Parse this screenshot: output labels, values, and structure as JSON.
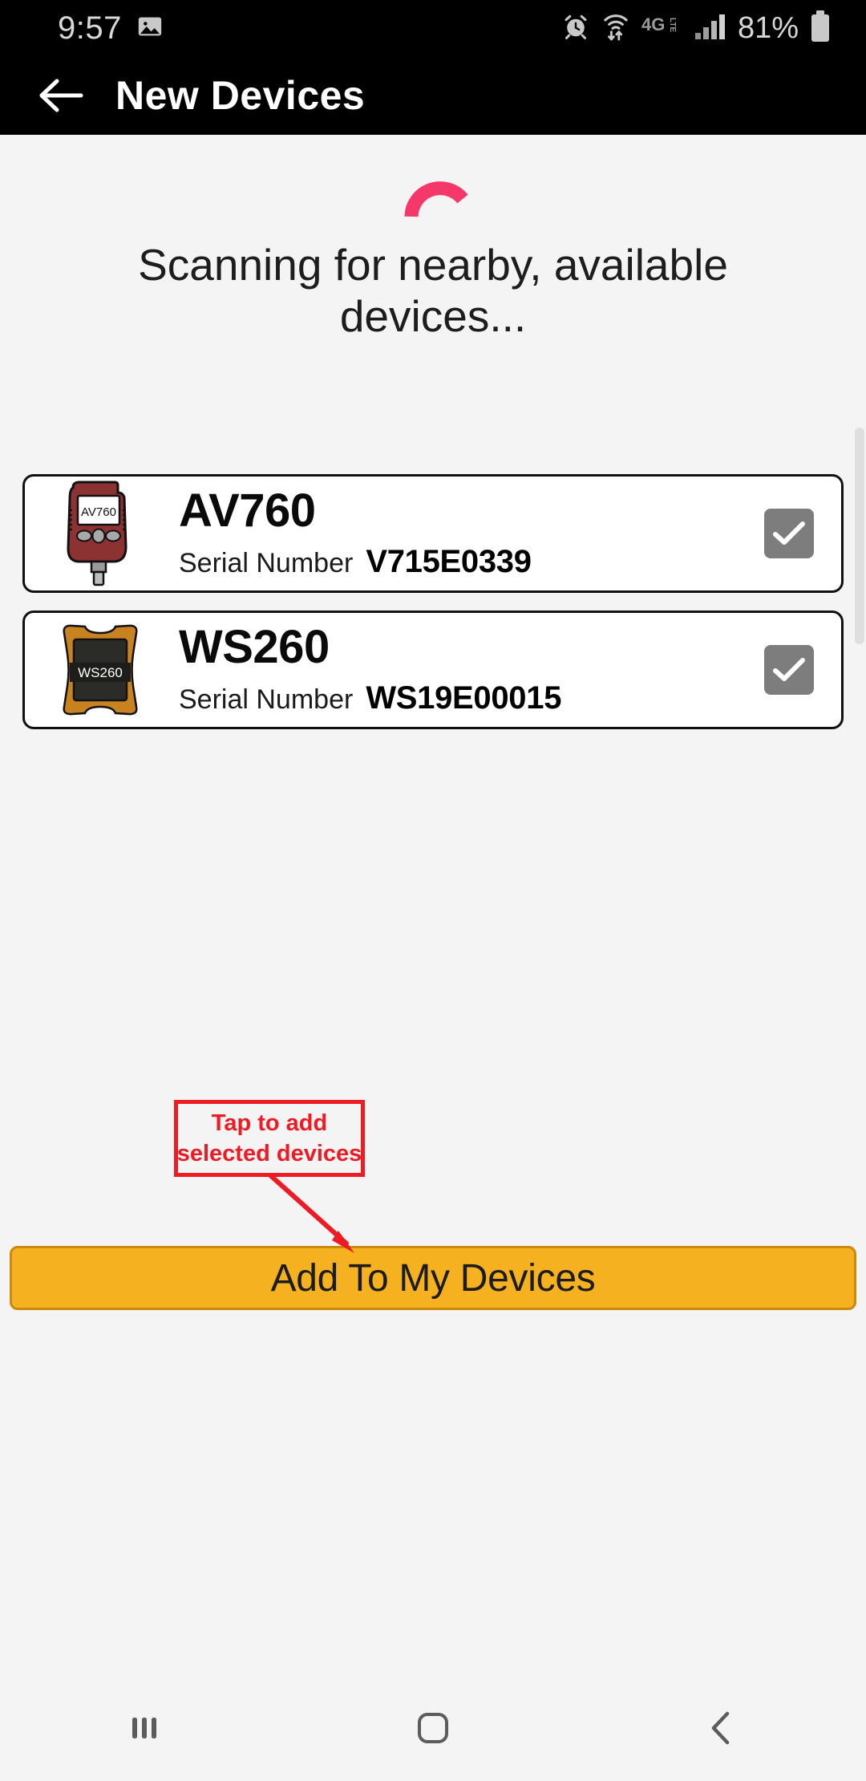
{
  "status_bar": {
    "time": "9:57",
    "battery_percent": "81%",
    "icons": [
      "photo-icon",
      "alarm-icon",
      "wifi-icon",
      "4glte-icon",
      "signal-icon",
      "battery-icon"
    ]
  },
  "app_bar": {
    "back_label": "back-arrow",
    "title": "New Devices"
  },
  "scanning": {
    "status_text": "Scanning for nearby, available devices...",
    "spinner_color": "#f4386a"
  },
  "devices": [
    {
      "name": "AV760",
      "serial_label": "Serial Number",
      "serial_value": "V715E0339",
      "screen_text": "AV760",
      "icon": "av760-gauge-icon",
      "body_color": "#8d3232",
      "checked": true
    },
    {
      "name": "WS260",
      "serial_label": "Serial Number",
      "serial_value": "WS19E00015",
      "screen_text": "WS260",
      "icon": "ws260-tablet-icon",
      "body_color": "#c8821f",
      "checked": true
    }
  ],
  "annotation": {
    "line1": "Tap to add",
    "line2": "selected devices",
    "color": "#ed1c24"
  },
  "cta": {
    "label": "Add To My Devices",
    "color": "#f5b120"
  },
  "nav_bar": {
    "recents": "recents-icon",
    "home": "home-icon",
    "back": "back-icon"
  }
}
